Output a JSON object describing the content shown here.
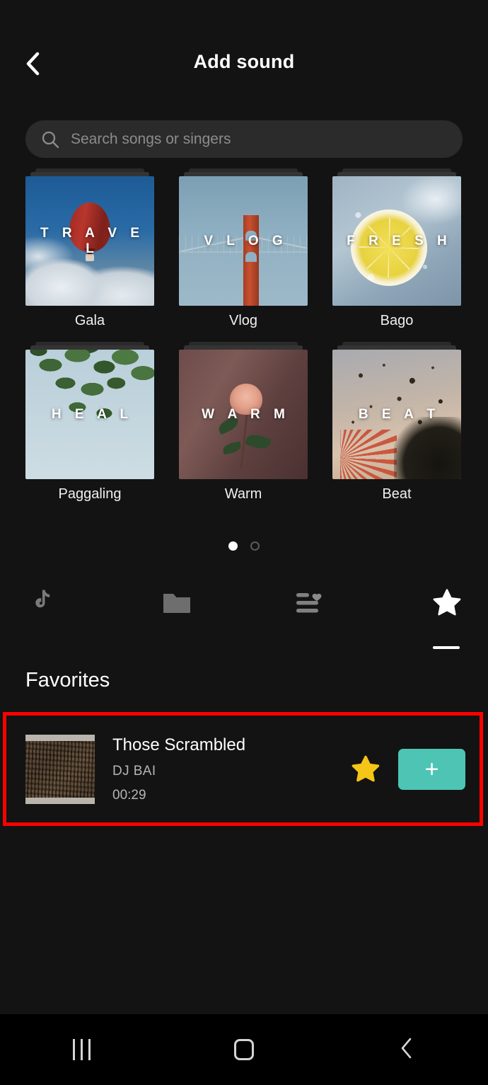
{
  "header": {
    "title": "Add sound",
    "back_icon": "chevron-left-icon"
  },
  "search": {
    "placeholder": "Search songs or singers",
    "value": "",
    "icon": "search-icon"
  },
  "categories": [
    {
      "overlay": "T R A V E L",
      "label": "Gala"
    },
    {
      "overlay": "V L O G",
      "label": "Vlog"
    },
    {
      "overlay": "F R E S H",
      "label": "Bago"
    },
    {
      "overlay": "H E A L",
      "label": "Paggaling"
    },
    {
      "overlay": "W A R M",
      "label": "Warm"
    },
    {
      "overlay": "B E A T",
      "label": "Beat"
    }
  ],
  "pager": {
    "total": 2,
    "active_index": 1
  },
  "tabs": [
    {
      "name": "tiktok",
      "icon": "tiktok-note-icon",
      "active": false
    },
    {
      "name": "folder",
      "icon": "folder-icon",
      "active": false
    },
    {
      "name": "playlist",
      "icon": "playlist-heart-icon",
      "active": false
    },
    {
      "name": "favorites",
      "icon": "star-icon",
      "active": true
    }
  ],
  "favorites": {
    "section_title": "Favorites",
    "songs": [
      {
        "title": "Those Scrambled",
        "artist": "DJ BAI",
        "duration": "00:29",
        "favorited": true,
        "add_label": "+"
      }
    ]
  },
  "system_nav": {
    "recents_icon": "recents-icon",
    "home_icon": "home-icon",
    "back_icon": "back-icon"
  },
  "colors": {
    "background": "#131313",
    "accent_teal": "#4ec5b4",
    "star_yellow": "#f5c518",
    "highlight_red": "#ff0000",
    "search_field": "#2b2b2b"
  }
}
